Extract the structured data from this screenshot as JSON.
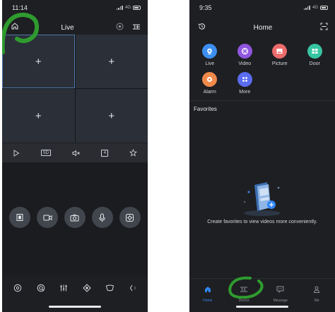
{
  "left_screen": {
    "status": {
      "time": "11:14",
      "network": "4G"
    },
    "header": {
      "title": "Live",
      "home_icon": "home-icon",
      "record_icon": "record-circle-icon",
      "device_icon": "device-list-icon"
    },
    "grid_cells": [
      {
        "glyph": "+",
        "selected": true
      },
      {
        "glyph": "+",
        "selected": false
      },
      {
        "glyph": "+",
        "selected": false
      },
      {
        "glyph": "+",
        "selected": false
      }
    ],
    "control_bar": {
      "play_icon": "play-icon",
      "quality_label": "SD",
      "mute_icon": "speaker-muted-icon",
      "split_label": "4",
      "favorite_icon": "star-icon"
    },
    "action_buttons": [
      "film-strip-icon",
      "video-record-icon",
      "snapshot-camera-icon",
      "microphone-icon",
      "ptz-control-icon"
    ],
    "ptz_controls": [
      "ptz-direction-icon",
      "zoom-icon",
      "equalizer-icon",
      "focus-icon",
      "iris-icon",
      "more-icon"
    ]
  },
  "right_screen": {
    "status": {
      "time": "9:35",
      "network": "4G"
    },
    "header": {
      "title": "Home",
      "history_icon": "history-icon",
      "scan_icon": "scan-icon"
    },
    "apps": [
      {
        "label": "Live",
        "icon": "live-camera-icon",
        "color": "#3d8ef0"
      },
      {
        "label": "Video",
        "icon": "video-playback-icon",
        "color": "#8f56df"
      },
      {
        "label": "Picture",
        "icon": "picture-icon",
        "color": "#ec6b6b"
      },
      {
        "label": "Door",
        "icon": "door-icon",
        "color": "#37c4a2"
      },
      {
        "label": "Alarm",
        "icon": "alarm-icon",
        "color": "#f08a4b"
      },
      {
        "label": "More",
        "icon": "more-apps-icon",
        "color": "#5a6cf0"
      }
    ],
    "favorites": {
      "title": "Favorites",
      "empty_message": "Create favorites to view videos more conveniently."
    },
    "tabbar": [
      {
        "label": "Home",
        "icon": "home-tab-icon",
        "active": true
      },
      {
        "label": "Device",
        "icon": "device-tab-icon",
        "active": false
      },
      {
        "label": "Message",
        "icon": "message-tab-icon",
        "active": false
      },
      {
        "label": "Me",
        "icon": "me-tab-icon",
        "active": false
      }
    ]
  },
  "colors": {
    "background": "#1e1f22",
    "accent": "#2f86f6",
    "annotation": "#2f9b2f"
  }
}
